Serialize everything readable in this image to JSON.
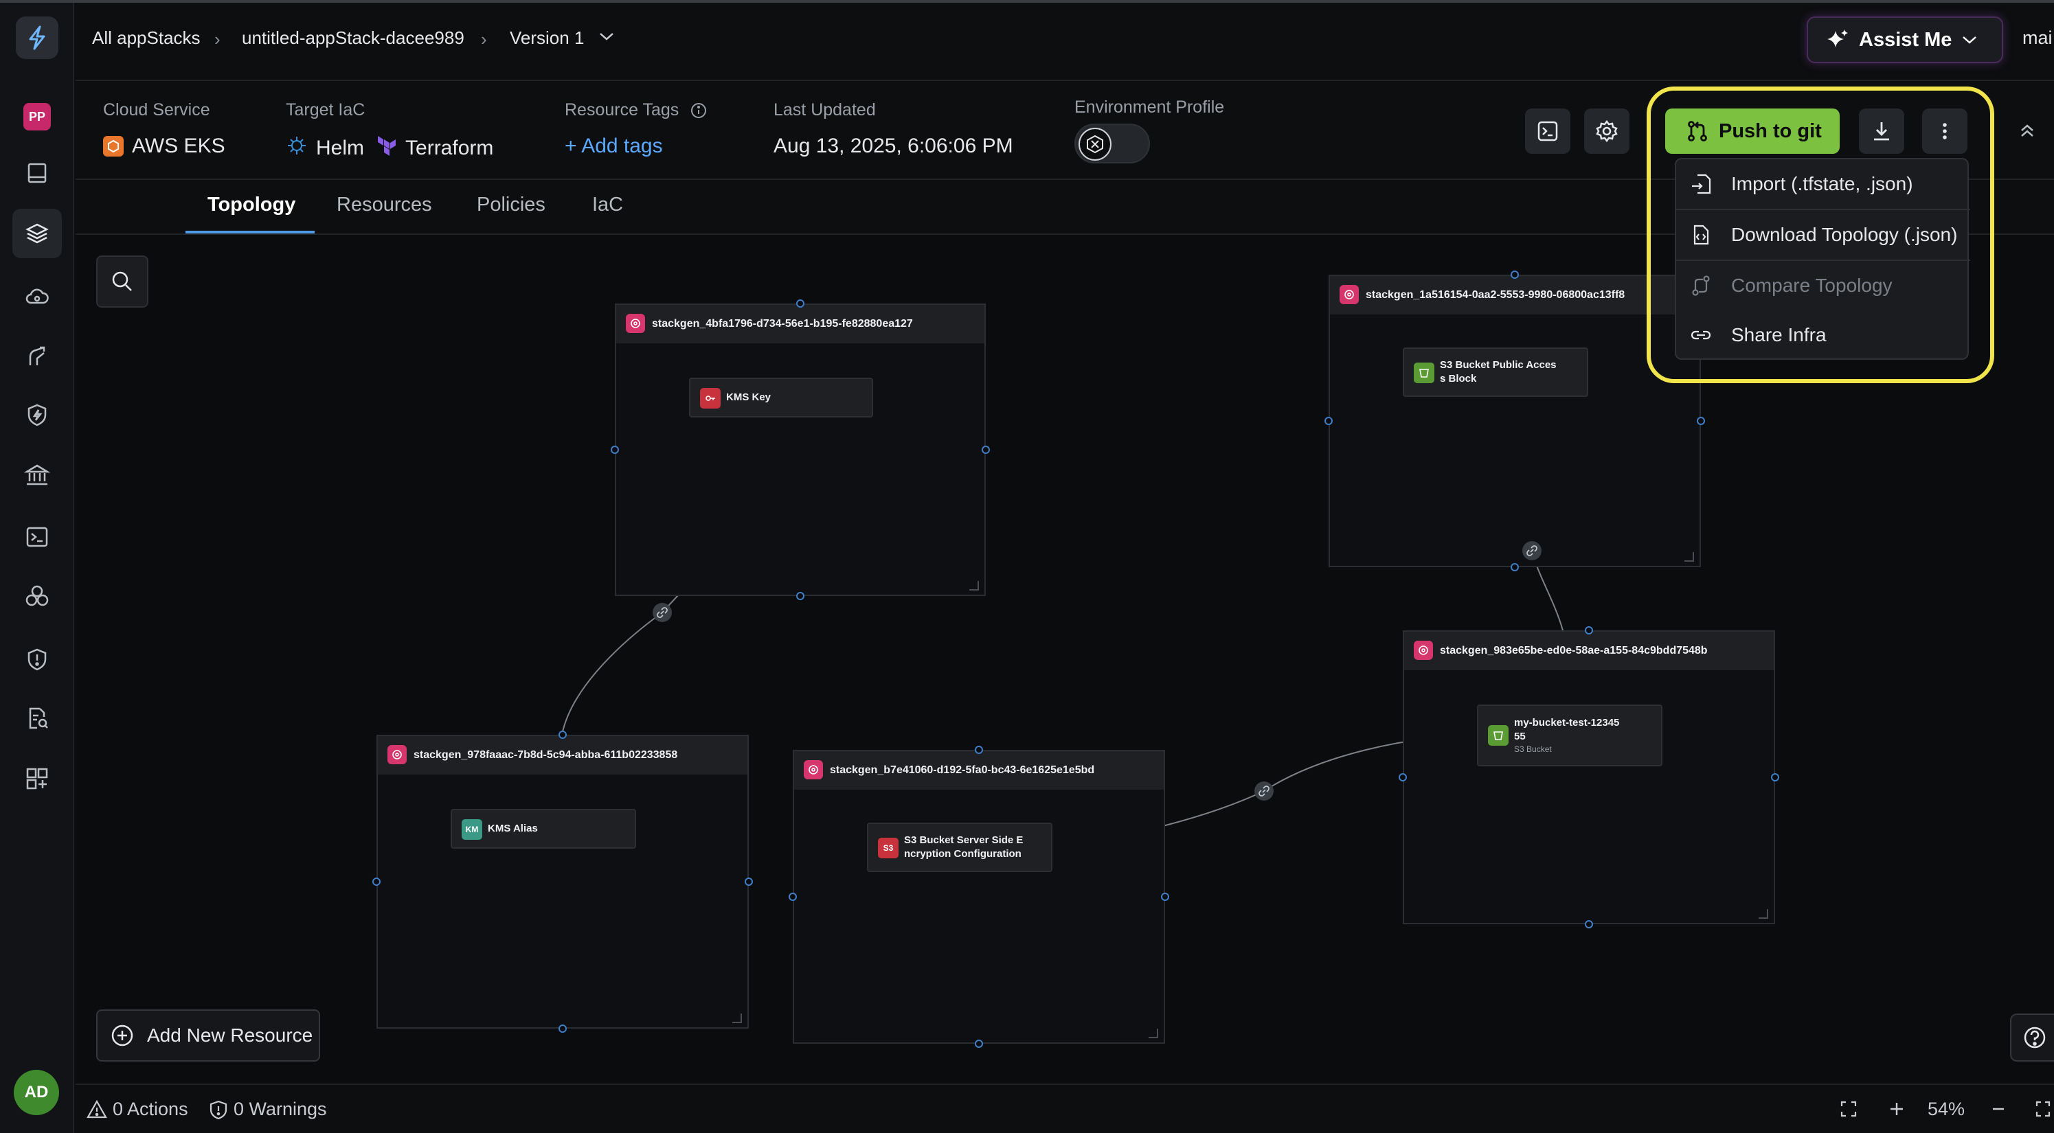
{
  "nav": {
    "avatar_initials": "PP",
    "user_initials": "AD",
    "items": [
      "docs-icon",
      "stack-icon",
      "cloud-icon",
      "git-branch-icon",
      "shield-bolt-icon",
      "bank-icon",
      "terminal-icon",
      "modules-icon",
      "shield-alert-icon",
      "audit-icon",
      "add-grid-icon"
    ]
  },
  "breadcrumb": {
    "root": "All appStacks",
    "stack": "untitled-appStack-dacee989",
    "version": "Version 1"
  },
  "assist": {
    "label": "Assist Me"
  },
  "user_truncated": "mai",
  "info": {
    "cloud_service_label": "Cloud Service",
    "cloud_service_value": "AWS EKS",
    "target_iac_label": "Target IaC",
    "iac_helm": "Helm",
    "iac_terraform": "Terraform",
    "resource_tags_label": "Resource Tags",
    "add_tags": "+ Add tags",
    "last_updated_label": "Last Updated",
    "last_updated_value": "Aug 13, 2025, 6:06:06 PM",
    "env_profile_label": "Environment Profile"
  },
  "actions": {
    "push_label": "Push to git"
  },
  "menu": {
    "import": "Import (.tfstate, .json)",
    "download": "Download Topology (.json)",
    "compare": "Compare Topology",
    "share": "Share Infra"
  },
  "tabs": {
    "topology": "Topology",
    "resources": "Resources",
    "policies": "Policies",
    "iac": "IaC"
  },
  "groups": {
    "g1": "stackgen_4bfa1796-d734-56e1-b195-fe82880ea127",
    "g2": "stackgen_1a516154-0aa2-5553-9980-06800ac13ff8",
    "g3": "stackgen_983e65be-ed0e-58ae-a155-84c9bdd7548b",
    "g4": "stackgen_978faaac-7b8d-5c94-abba-611b02233858",
    "g5": "stackgen_b7e41060-d192-5fa0-bc43-6e1625e1e5bd"
  },
  "resources": {
    "kms_key": "KMS Key",
    "s3_public_l1": "S3 Bucket Public Acces",
    "s3_public_l2": "s Block",
    "bucket_l1": "my-bucket-test-12345",
    "bucket_l2": "55",
    "bucket_type": "S3 Bucket",
    "kms_alias": "KMS Alias",
    "kms_alias_icon": "KM",
    "sse_l1": "S3 Bucket Server Side E",
    "sse_l2": "ncryption Configuration",
    "sse_icon": "S3"
  },
  "canvas": {
    "add_resource": "Add New Resource"
  },
  "status": {
    "actions": "0 Actions",
    "warnings": "0 Warnings",
    "zoom": "54%"
  },
  "colors": {
    "accent_green": "#7cc13f",
    "highlight_yellow": "#f2e54c",
    "link_blue": "#5aa8ff",
    "group_icon_pink": "#d6366b"
  }
}
